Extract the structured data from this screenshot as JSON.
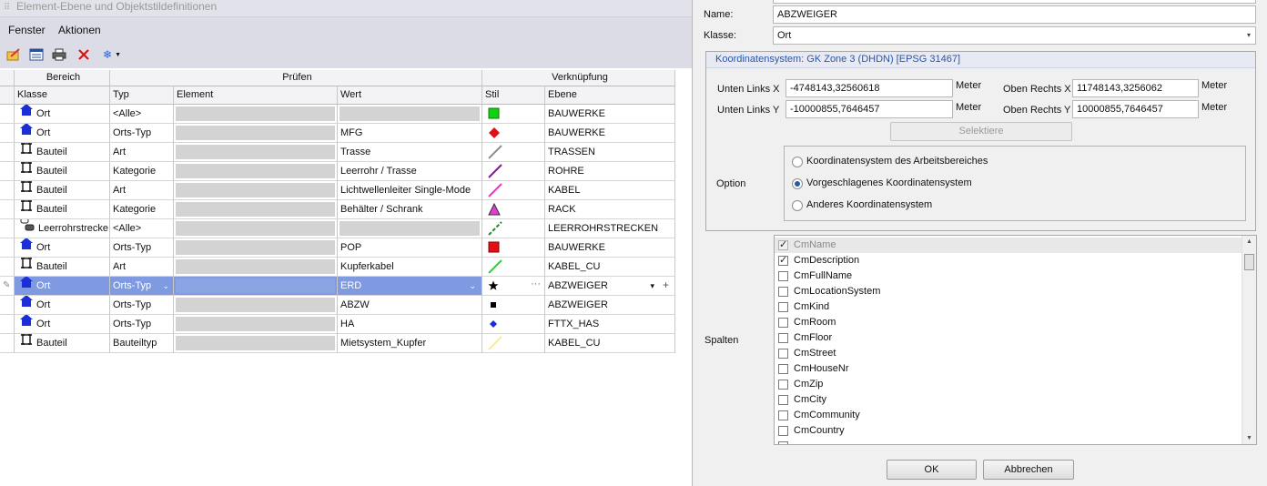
{
  "left_panel": {
    "title": "Element-Ebene und Objektstildefinitionen",
    "menu": [
      "Fenster",
      "Aktionen"
    ],
    "toolbar_icons": [
      "edit-icon",
      "list-icon",
      "print-icon",
      "delete-icon",
      "snowflake-dropdown-icon"
    ]
  },
  "grid": {
    "group_headers": [
      "Bereich",
      "Prüfen",
      "Verknüpfung"
    ],
    "columns": [
      "Klasse",
      "Typ",
      "Element",
      "Wert",
      "Stil",
      "Ebene"
    ],
    "rows": [
      {
        "klasse": "Ort",
        "klasse_icon": "house-icon",
        "typ": "<Alle>",
        "element": "",
        "wert": "",
        "stil": "green-square",
        "ebene": "BAUWERKE"
      },
      {
        "klasse": "Ort",
        "klasse_icon": "house-icon",
        "typ": "Orts-Typ",
        "element": "",
        "wert": "MFG",
        "stil": "red-diamond",
        "ebene": "BAUWERKE"
      },
      {
        "klasse": "Bauteil",
        "klasse_icon": "bracket-icon",
        "typ": "Art",
        "element": "",
        "wert": "Trasse",
        "stil": "gray-line",
        "ebene": "TRASSEN"
      },
      {
        "klasse": "Bauteil",
        "klasse_icon": "bracket-icon",
        "typ": "Kategorie",
        "element": "",
        "wert": "Leerrohr / Trasse",
        "stil": "purple-line",
        "ebene": "ROHRE"
      },
      {
        "klasse": "Bauteil",
        "klasse_icon": "bracket-icon",
        "typ": "Art",
        "element": "",
        "wert": "Lichtwellenleiter Single-Mode",
        "stil": "magenta-line",
        "ebene": "KABEL"
      },
      {
        "klasse": "Bauteil",
        "klasse_icon": "bracket-icon",
        "typ": "Kategorie",
        "element": "",
        "wert": "Behälter / Schrank",
        "stil": "magenta-triangle",
        "ebene": "RACK"
      },
      {
        "klasse": "Leerrohrstrecke",
        "klasse_icon": "duct-icon",
        "typ": "<Alle>",
        "element": "",
        "wert": "",
        "stil": "green-dashed-line",
        "ebene": "LEERROHRSTRECKEN"
      },
      {
        "klasse": "Ort",
        "klasse_icon": "house-icon",
        "typ": "Orts-Typ",
        "element": "",
        "wert": "POP",
        "stil": "red-square",
        "ebene": "BAUWERKE"
      },
      {
        "klasse": "Bauteil",
        "klasse_icon": "bracket-icon",
        "typ": "Art",
        "element": "",
        "wert": "Kupferkabel",
        "stil": "green-line",
        "ebene": "KABEL_CU"
      },
      {
        "klasse": "Ort",
        "klasse_icon": "house-icon",
        "typ": "Orts-Typ",
        "element": "",
        "wert": "ERD",
        "stil": "black-star",
        "ebene": "ABZWEIGER",
        "selected": true
      },
      {
        "klasse": "Ort",
        "klasse_icon": "house-icon",
        "typ": "Orts-Typ",
        "element": "",
        "wert": "ABZW",
        "stil": "black-square",
        "ebene": "ABZWEIGER"
      },
      {
        "klasse": "Ort",
        "klasse_icon": "house-icon",
        "typ": "Orts-Typ",
        "element": "",
        "wert": "HA",
        "stil": "blue-diamond",
        "ebene": "FTTX_HAS"
      },
      {
        "klasse": "Bauteil",
        "klasse_icon": "bracket-icon",
        "typ": "Bauteiltyp",
        "element": "",
        "wert": "Mietsystem_Kupfer",
        "stil": "yellow-line",
        "ebene": "KABEL_CU"
      }
    ]
  },
  "dialog": {
    "name_label": "Name:",
    "name_value": "ABZWEIGER",
    "klasse_label": "Klasse:",
    "klasse_value": "Ort",
    "koord_title": "Koordinatensystem: GK Zone 3 (DHDN) [EPSG 31467]",
    "unten_links_x_label": "Unten Links X",
    "unten_links_x_value": "-4748143,32560618",
    "unten_links_y_label": "Unten Links Y",
    "unten_links_y_value": "-10000855,7646457",
    "oben_rechts_x_label": "Oben Rechts X",
    "oben_rechts_x_value": "11748143,3256062",
    "oben_rechts_y_label": "Oben Rechts Y",
    "oben_rechts_y_value": "10000855,7646457",
    "unit": "Meter",
    "selektiere_label": "Selektiere",
    "option_label": "Option",
    "options": [
      "Koordinatensystem des Arbeitsbereiches",
      "Vorgeschlagenes Koordinatensystem",
      "Anderes Koordinatensystem"
    ],
    "selected_option": "Vorgeschlagenes Koordinatensystem",
    "spalten_label": "Spalten",
    "spalten": [
      {
        "name": "CmName",
        "checked": true,
        "disabled": true
      },
      {
        "name": "CmDescription",
        "checked": true
      },
      {
        "name": "CmFullName",
        "checked": false
      },
      {
        "name": "CmLocationSystem",
        "checked": false
      },
      {
        "name": "CmKind",
        "checked": false
      },
      {
        "name": "CmRoom",
        "checked": false
      },
      {
        "name": "CmFloor",
        "checked": false
      },
      {
        "name": "CmStreet",
        "checked": false
      },
      {
        "name": "CmHouseNr",
        "checked": false
      },
      {
        "name": "CmZip",
        "checked": false
      },
      {
        "name": "CmCity",
        "checked": false
      },
      {
        "name": "CmCommunity",
        "checked": false
      },
      {
        "name": "CmCountry",
        "checked": false
      }
    ],
    "ok_label": "OK",
    "cancel_label": "Abbrechen"
  }
}
